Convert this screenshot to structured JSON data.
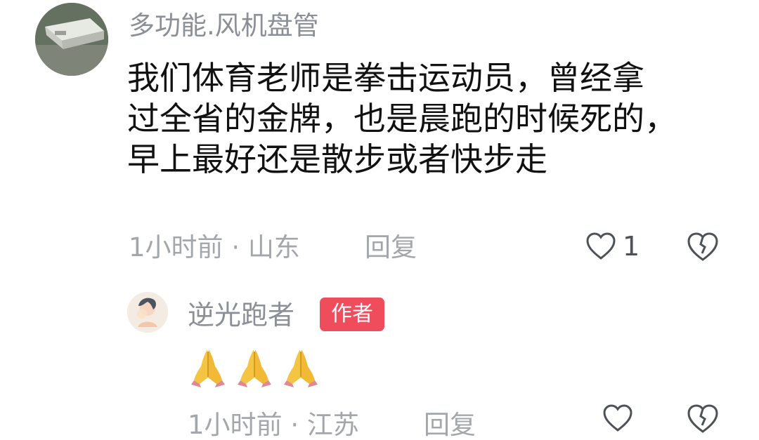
{
  "comment": {
    "username": "多功能.风机盘管",
    "text_lines": [
      "我们体育老师是拳击运动员，曾经拿",
      "过全省的金牌，也是晨跑的时候死的，",
      "早上最好还是散步或者快步走"
    ],
    "time": "1小时前",
    "location": "山东",
    "reply_label": "回复",
    "like_count": "1"
  },
  "reply": {
    "username": "逆光跑者",
    "author_badge": "作者",
    "emoji_count": 3,
    "time": "1小时前",
    "location": "江苏",
    "reply_label": "回复"
  },
  "icons": {
    "like": "heart-outline-icon",
    "dislike": "broken-heart-icon",
    "emoji": "folded-hands-emoji"
  },
  "colors": {
    "badge": "#ef4c5c",
    "muted_text": "#a3a6ab",
    "username": "#8b8f97"
  }
}
